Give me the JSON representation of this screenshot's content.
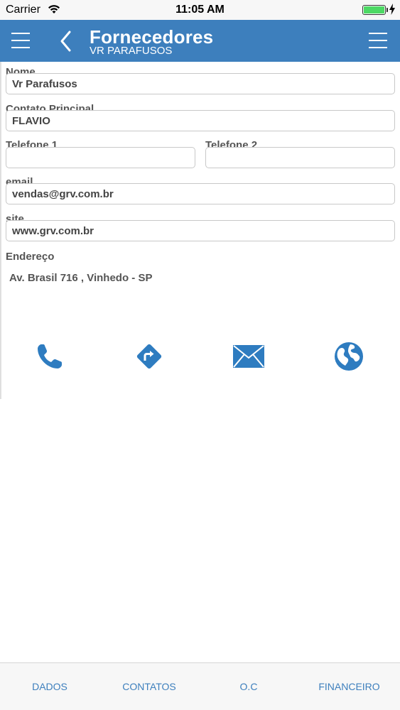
{
  "status_bar": {
    "carrier": "Carrier",
    "time": "11:05 AM",
    "battery_level": 1.0
  },
  "nav": {
    "title": "Fornecedores",
    "subtitle": "VR PARAFUSOS"
  },
  "form": {
    "nome": {
      "label": "Nome",
      "value": "Vr Parafusos"
    },
    "contato": {
      "label": "Contato Principal",
      "value": "FLAVIO"
    },
    "telefone1": {
      "label": "Telefone 1",
      "value": ""
    },
    "telefone2": {
      "label": "Telefone 2",
      "value": ""
    },
    "email": {
      "label": "email",
      "value": "vendas@grv.com.br"
    },
    "site": {
      "label": "site",
      "value": "www.grv.com.br"
    },
    "endereco": {
      "label": "Endereço",
      "value": "Av. Brasil 716 , Vinhedo - SP"
    }
  },
  "actions": [
    {
      "icon": "phone-icon"
    },
    {
      "icon": "directions-icon"
    },
    {
      "icon": "mail-icon"
    },
    {
      "icon": "globe-icon"
    }
  ],
  "tabs": [
    {
      "label": "DADOS"
    },
    {
      "label": "CONTATOS"
    },
    {
      "label": "O.C"
    },
    {
      "label": "FINANCEIRO"
    }
  ],
  "colors": {
    "accent": "#3d7fbd",
    "icon": "#2e7cc0"
  }
}
